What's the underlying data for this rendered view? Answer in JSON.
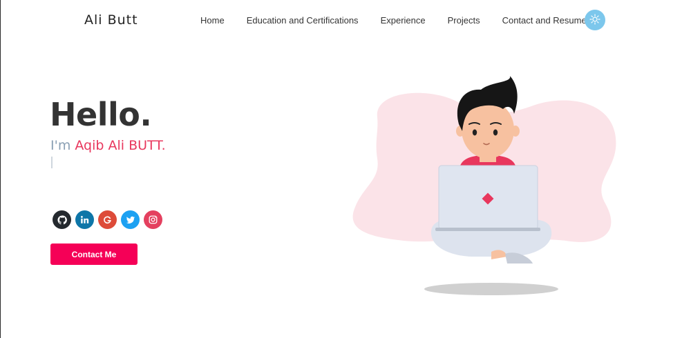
{
  "header": {
    "logo": "Ali Butt",
    "nav": [
      {
        "label": "Home"
      },
      {
        "label": "Education and Certifications"
      },
      {
        "label": "Experience"
      },
      {
        "label": "Projects"
      },
      {
        "label": "Contact and Resume"
      }
    ],
    "theme_toggle_icon": "sun-icon"
  },
  "hero": {
    "greeting": "Hello.",
    "intro_prefix": "I'm ",
    "intro_name": "Aqib Ali BUTT.",
    "cta_label": "Contact Me"
  },
  "socials": [
    {
      "name": "github",
      "icon": "github-icon",
      "color": "#24292e"
    },
    {
      "name": "linkedin",
      "icon": "linkedin-icon",
      "color": "#0e76a8"
    },
    {
      "name": "google",
      "icon": "google-icon",
      "color": "#dd4b39"
    },
    {
      "name": "twitter",
      "icon": "twitter-icon",
      "color": "#1da1f2"
    },
    {
      "name": "instagram",
      "icon": "instagram-icon",
      "color": "#e4405f"
    }
  ],
  "colors": {
    "accent": "#f50057",
    "name": "#e8375d",
    "muted": "#8aa0b4",
    "blob": "#fbe3e8",
    "toggle": "#7cc7ec"
  }
}
